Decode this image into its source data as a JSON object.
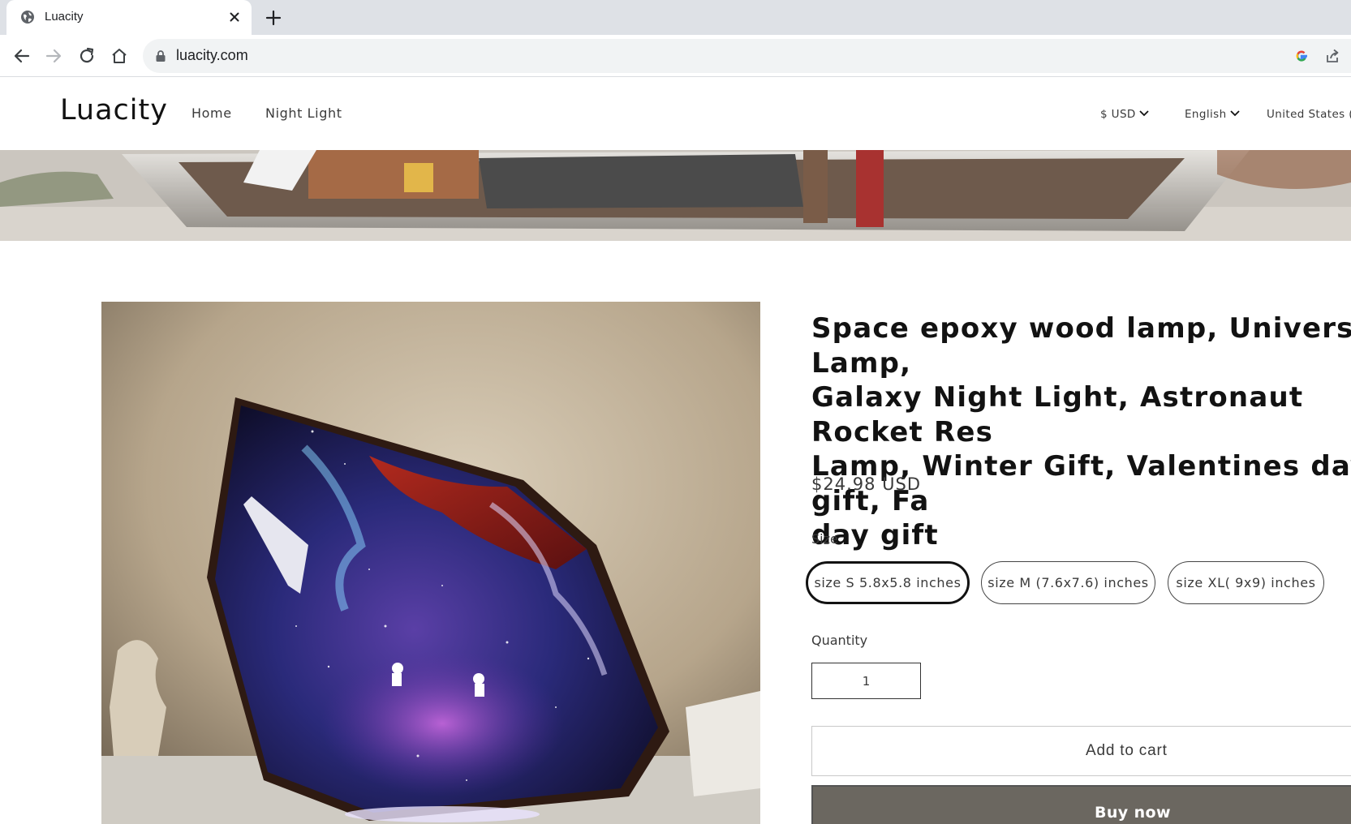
{
  "browser": {
    "tab_title": "Luacity",
    "url": "luacity.com"
  },
  "header": {
    "logo": "Luacity",
    "nav": [
      "Home",
      "Night Light"
    ],
    "currency": "$ USD",
    "language": "English",
    "country": "United States ("
  },
  "product": {
    "title_lines": [
      "Space epoxy wood lamp, Universe Lamp,",
      "Galaxy Night Light, Astronaut Rocket Res",
      "Lamp, Winter Gift, Valentines day gift, Fa",
      "day gift"
    ],
    "price": "$24.98 USD",
    "size_label": "Size",
    "sizes": [
      "size S 5.8x5.8 inches",
      "size M (7.6x7.6) inches",
      "size XL( 9x9) inches"
    ],
    "selected_size_index": 0,
    "quantity_label": "Quantity",
    "quantity": "1",
    "add_to_cart": "Add to cart",
    "buy_now": "Buy now"
  },
  "colors": {
    "buy_now_bg": "#6b6760",
    "text": "#121212"
  }
}
